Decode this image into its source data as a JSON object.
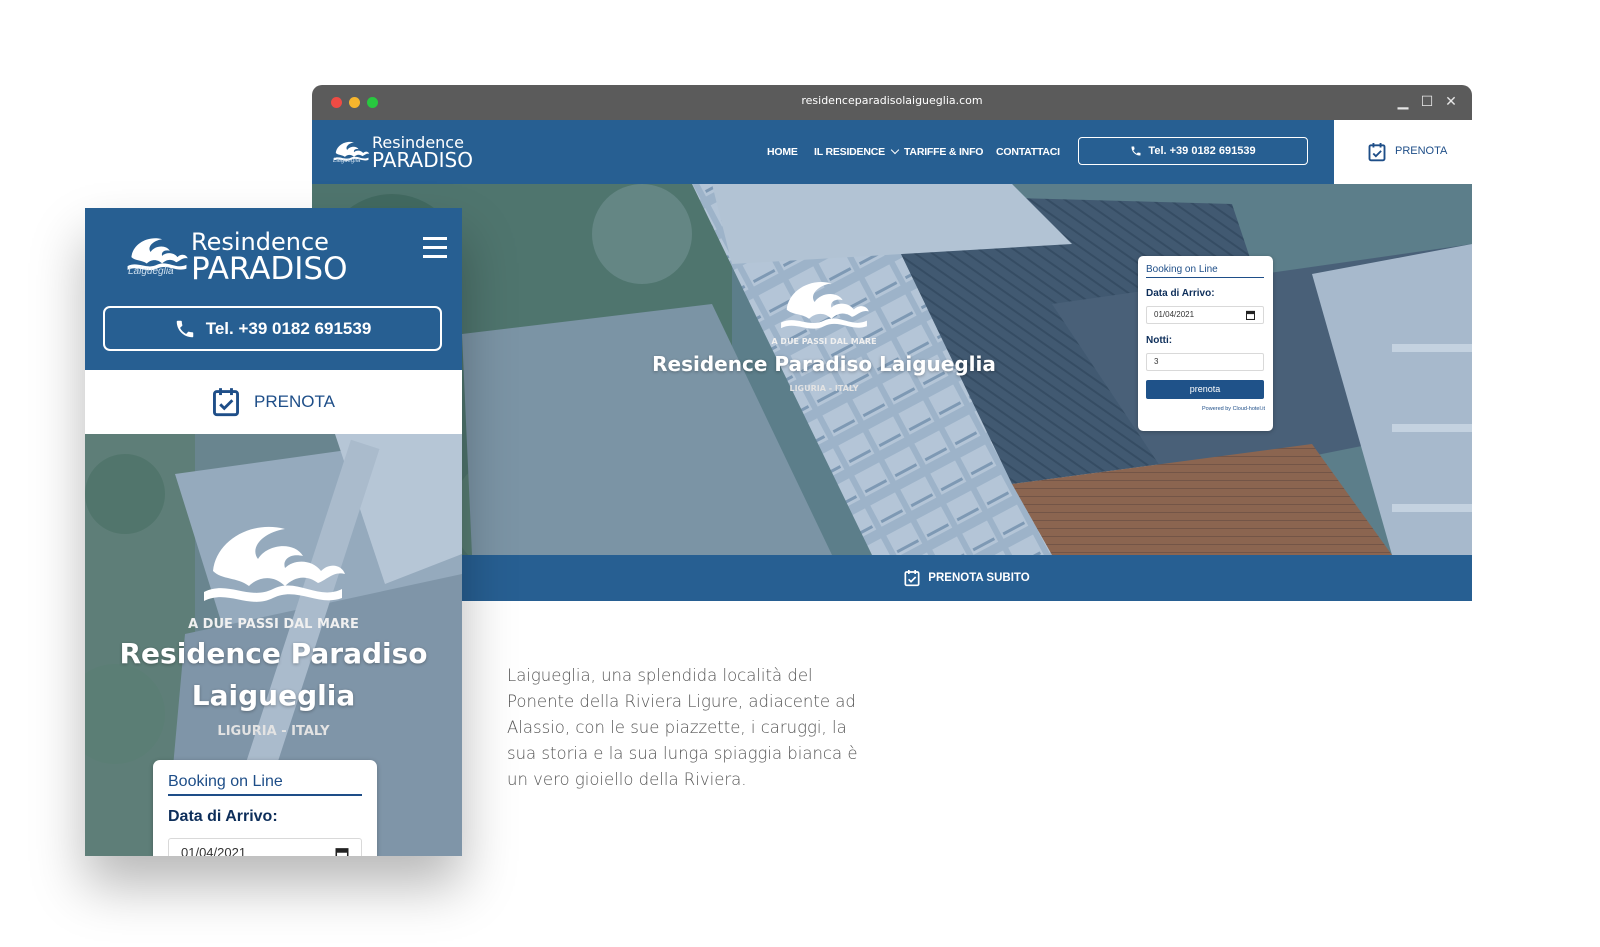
{
  "browser": {
    "url": "residenceparadisolaigueglia.com"
  },
  "logo": {
    "line1": "Resindence",
    "line2": "PARADISO",
    "script": "Laigueglia"
  },
  "nav": {
    "items": [
      "HOME",
      "IL RESIDENCE",
      "TARIFFE & INFO",
      "CONTATTACI"
    ],
    "phone": "Tel. +39 0182 691539",
    "prenota": "PRENOTA"
  },
  "hero": {
    "kicker": "A DUE PASSI DAL MARE",
    "title": "Residence Paradiso Laigueglia",
    "title_line1": "Residence Paradiso",
    "title_line2": "Laigueglia",
    "subtitle": "LIGURIA - ITALY"
  },
  "booking": {
    "title": "Booking on Line",
    "arrival_label": "Data di Arrivo:",
    "arrival_value": "01/04/2021",
    "nights_label": "Notti:",
    "nights_value": "3",
    "button": "prenota",
    "powered": "Powered by Cloud-hotel.it"
  },
  "cta": {
    "prenota_subito": "PRENOTA SUBITO"
  },
  "description": "Laigueglia, una splendida località del Ponente della Riviera Ligure, adiacente ad Alassio, con le sue piazzette, i caruggi, la sua storia e la sua lunga spiaggia bianca è un vero gioiello della Riviera.",
  "colors": {
    "brand_blue": "#275f92",
    "button_blue": "#1f5289",
    "titlebar": "#5b5b5b"
  },
  "icons": [
    "phone-icon",
    "calendar-check-icon",
    "hamburger-menu-icon",
    "chevron-down-icon",
    "wave-logo-icon",
    "calendar-picker-icon"
  ]
}
